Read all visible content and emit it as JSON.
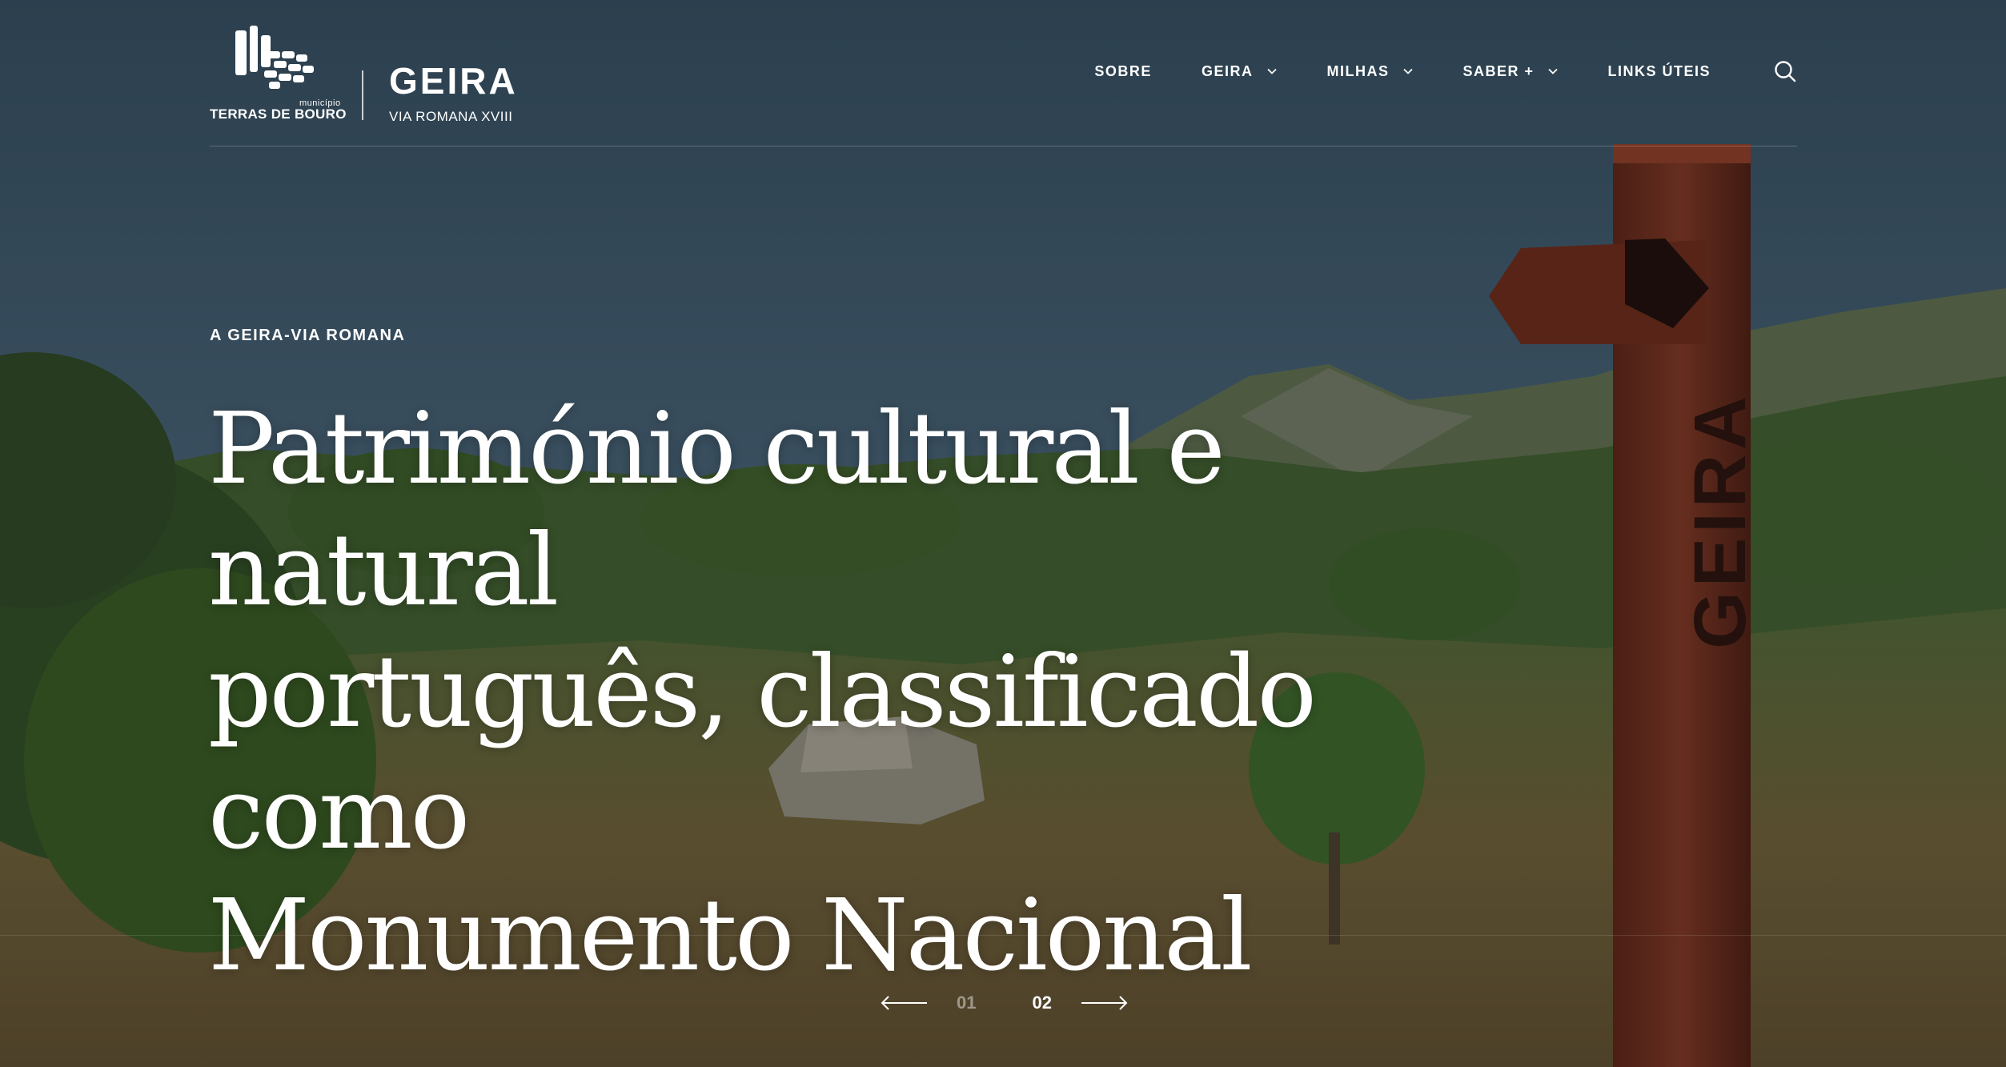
{
  "brand": {
    "municipio_small": "município",
    "municipio_name": "TERRAS DE BOURO",
    "site_title": "GEIRA",
    "site_subtitle": "VIA ROMANA XVIII"
  },
  "nav": {
    "items": [
      {
        "label": "SOBRE",
        "has_dropdown": false
      },
      {
        "label": "GEIRA",
        "has_dropdown": true
      },
      {
        "label": "MILHAS",
        "has_dropdown": true
      },
      {
        "label": "SABER +",
        "has_dropdown": true
      },
      {
        "label": "LINKS ÚTEIS",
        "has_dropdown": false
      }
    ],
    "search_icon": "search-icon"
  },
  "hero": {
    "eyebrow": "A GEIRA-VIA ROMANA",
    "headline_lines": [
      "Património cultural e natural",
      "português, classificado como",
      "Monumento Nacional"
    ],
    "signpost_text": "GEIRA"
  },
  "slider": {
    "slides": [
      "01",
      "02"
    ],
    "active_index": 1,
    "prev_icon": "arrow-left-icon",
    "next_icon": "arrow-right-icon"
  },
  "colors": {
    "sky": "#3f5666",
    "hill_green": "#3d5a2c",
    "heather": "#7a5a34",
    "signpost": "#6e2c1c",
    "text": "#ffffff"
  }
}
